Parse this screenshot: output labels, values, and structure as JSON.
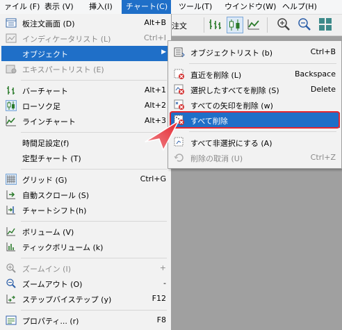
{
  "menubar": {
    "file": "ァイル (F)",
    "view": "表示 (V)",
    "insert": "挿入(I)",
    "chart": "チャート(C)",
    "tools": "ツール(T)",
    "window": "ウインドウ(W)",
    "help": "ヘルプ(H)"
  },
  "toolbar": {
    "partial_label": "注文"
  },
  "menu": {
    "order_panel": {
      "label": "板注文画面 (D)",
      "shortcut": "Alt+B"
    },
    "indicator_list": {
      "label": "インディケータリスト (L)",
      "shortcut": "Ctrl+I"
    },
    "objects": {
      "label": "オブジェクト"
    },
    "expert_list": {
      "label": "エキスパートリスト (E)"
    },
    "bar_chart": {
      "label": "バーチャート",
      "shortcut": "Alt+1"
    },
    "candles": {
      "label": "ローソク足",
      "shortcut": "Alt+2"
    },
    "line_chart": {
      "label": "ラインチャート",
      "shortcut": "Alt+3"
    },
    "timeframe": {
      "label": "時間足設定(f)"
    },
    "template": {
      "label": "定型チャート (T)"
    },
    "grid": {
      "label": "グリッド (G)",
      "shortcut": "Ctrl+G"
    },
    "autoscroll": {
      "label": "自動スクロール (S)"
    },
    "chart_shift": {
      "label": "チャートシフト(h)"
    },
    "volume": {
      "label": "ボリューム (V)"
    },
    "tick_volume": {
      "label": "ティックボリューム (k)"
    },
    "zoom_in": {
      "label": "ズームイン (I)",
      "shortcut": "+"
    },
    "zoom_out": {
      "label": "ズームアウト (O)",
      "shortcut": "-"
    },
    "step": {
      "label": "ステップバイステップ (y)",
      "shortcut": "F12"
    },
    "properties": {
      "label": "プロパティ... (r)",
      "shortcut": "F8"
    }
  },
  "submenu": {
    "object_list": {
      "label": "オブジェクトリスト (b)",
      "shortcut": "Ctrl+B"
    },
    "delete_last": {
      "label": "直近を削除 (L)",
      "shortcut": "Backspace"
    },
    "delete_selected": {
      "label": "選択したすべてを削除 (S)",
      "shortcut": "Delete"
    },
    "delete_arrows": {
      "label": "すべての矢印を削除 (w)"
    },
    "delete_all": {
      "label": "すべて削除"
    },
    "deselect_all": {
      "label": "すべて非選択にする (A)"
    },
    "undo_delete": {
      "label": "削除の取消 (U)",
      "shortcut": "Ctrl+Z"
    }
  },
  "colors": {
    "highlight": "#1f6fc8",
    "callout": "#e4262f"
  }
}
